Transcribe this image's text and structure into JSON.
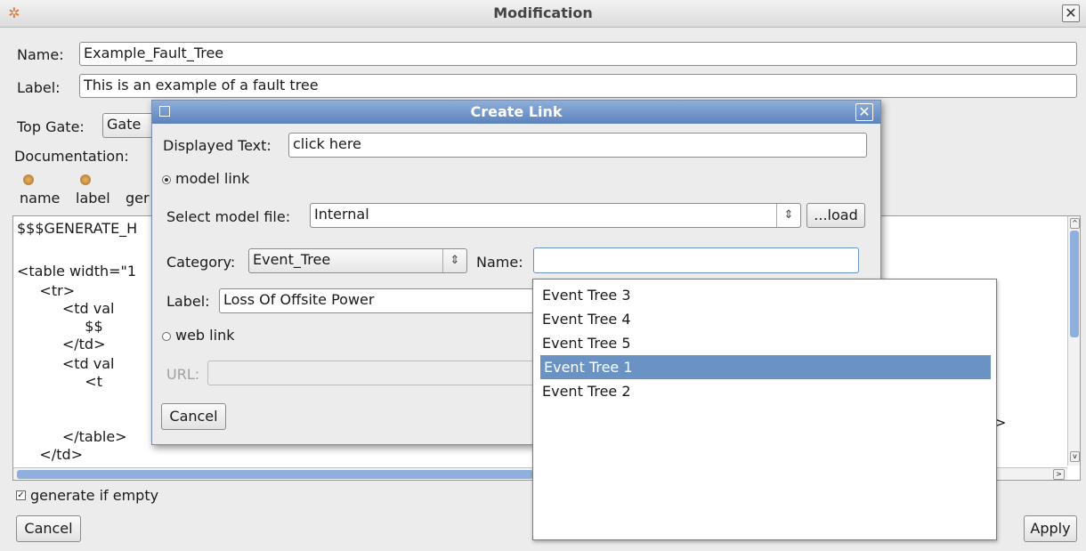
{
  "window": {
    "title": "Modification",
    "close": "✕"
  },
  "form": {
    "name_label": "Name:",
    "name_value": "Example_Fault_Tree",
    "label_label": "Label:",
    "label_value": "This is an example of a fault tree",
    "top_gate_label": "Top Gate:",
    "top_gate_value": "Gate",
    "documentation_label": "Documentation:",
    "toolbar": [
      {
        "label": "name",
        "icon": "gear-icon"
      },
      {
        "label": "label",
        "icon": "gear-icon"
      },
      {
        "label": "ger",
        "icon": "gear-icon"
      }
    ],
    "code_lines": [
      "$$$GENERATE_H",
      "",
      "<table width=\"1",
      "     <tr>",
      "          <td val",
      "               $$",
      "          </td>",
      "          <td val",
      "               <t",
      "",
      "          </table>",
      "     </td>"
    ],
    "right_gt": ">",
    "generate_if_empty": "generate if empty",
    "cancel": "Cancel",
    "apply": "Apply"
  },
  "dialog": {
    "title": "Create Link",
    "displayed_text_label": "Displayed Text:",
    "displayed_text_value": "click here",
    "model_link": "model link",
    "select_model_label": "Select model file:",
    "select_model_value": "Internal",
    "load_button": "...load",
    "category_label": "Category:",
    "category_value": "Event_Tree",
    "name_label": "Name:",
    "name_value": "",
    "label_label": "Label:",
    "label_value": "Loss Of Offsite Power",
    "web_link": "web link",
    "url_label": "URL:",
    "cancel": "Cancel"
  },
  "dropdown": {
    "items": [
      "Event Tree 3",
      "Event Tree 4",
      "Event Tree 5",
      "Event Tree 1",
      "Event Tree 2"
    ],
    "selected": "Event Tree 1"
  },
  "colors": {
    "selection": "#6a93c4",
    "dialog_title": "#5c83bf"
  }
}
